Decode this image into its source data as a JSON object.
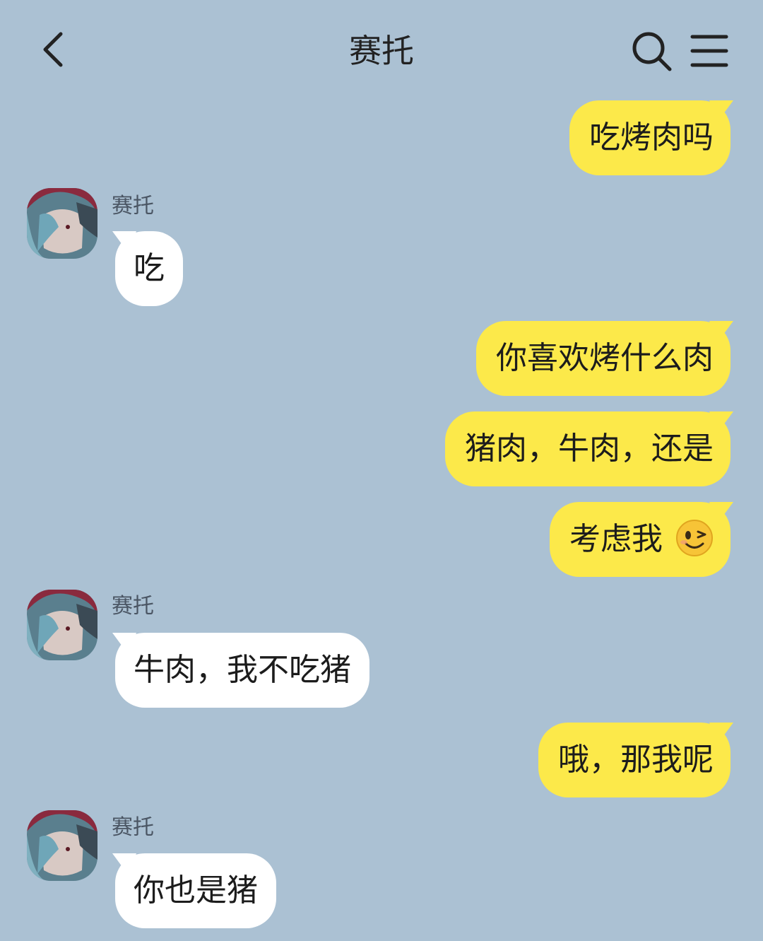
{
  "header": {
    "title": "赛托"
  },
  "contact": {
    "name": "赛托"
  },
  "messages": [
    {
      "from": "me",
      "text": "吃烤肉吗"
    },
    {
      "from": "them",
      "sender": "赛托",
      "text": "吃"
    },
    {
      "from": "me",
      "text": "你喜欢烤什么肉"
    },
    {
      "from": "me",
      "text": "猪肉，牛肉，还是"
    },
    {
      "from": "me",
      "text": "考虑我",
      "emoji": "wink-emoji"
    },
    {
      "from": "them",
      "sender": "赛托",
      "text": "牛肉，我不吃猪"
    },
    {
      "from": "me",
      "text": "哦，那我呢"
    },
    {
      "from": "them",
      "sender": "赛托",
      "text": "你也是猪"
    }
  ],
  "icons": {
    "back": "chevron-left-icon",
    "search": "search-icon",
    "menu": "hamburger-menu-icon"
  },
  "colors": {
    "background": "#abc1d3",
    "my_bubble": "#fce94a",
    "their_bubble": "#ffffff"
  }
}
